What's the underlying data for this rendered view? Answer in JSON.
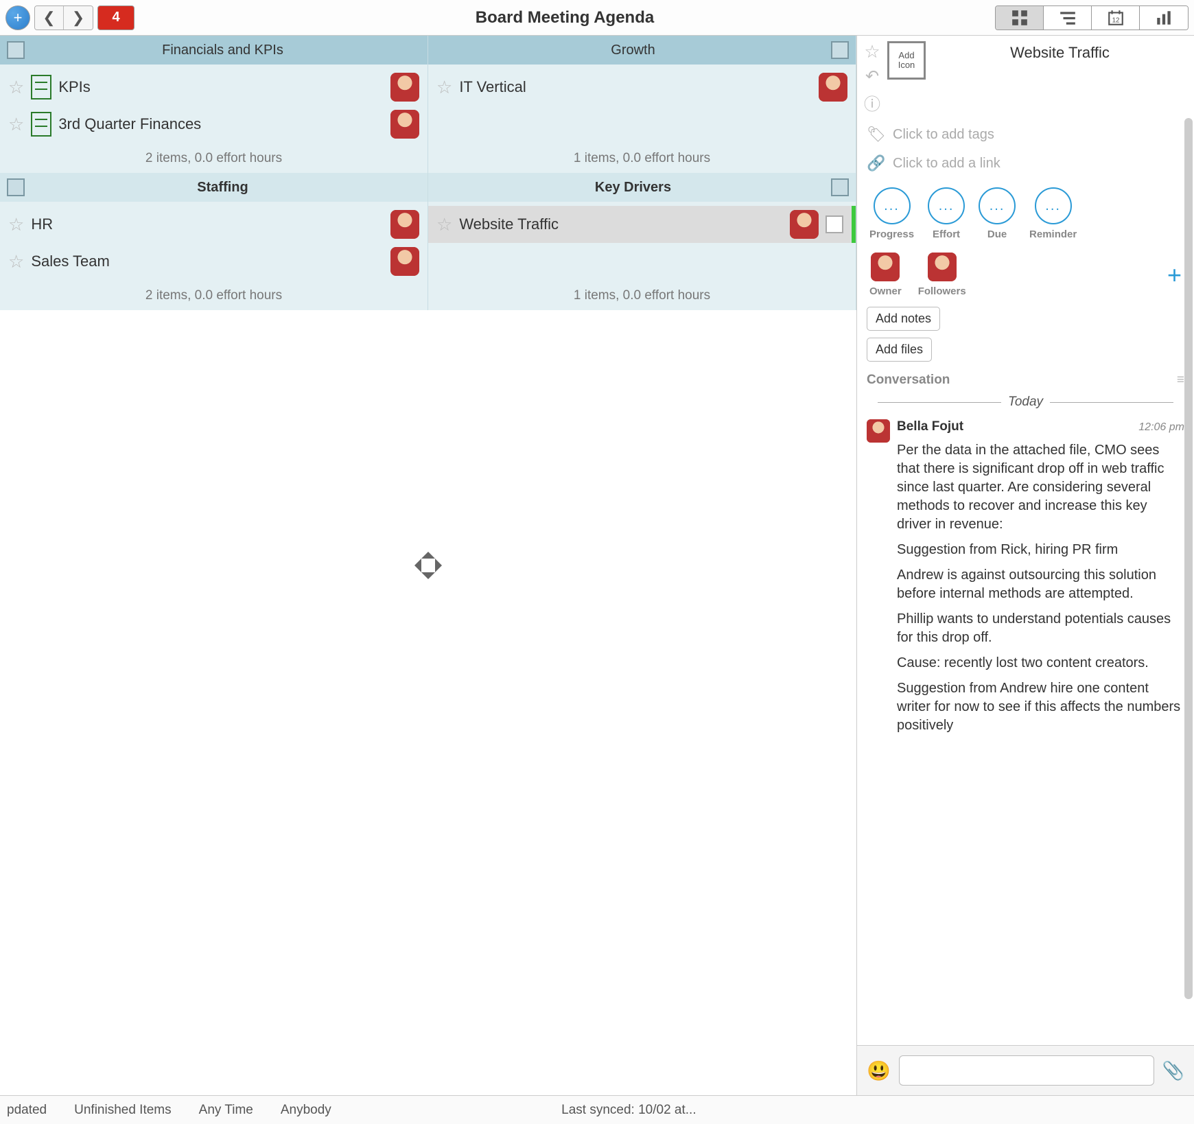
{
  "topbar": {
    "badge": "4",
    "title": "Board Meeting Agenda"
  },
  "quads": [
    {
      "title": "Financials and KPIs",
      "footer": "2 items, 0.0 effort hours",
      "cards": [
        {
          "title": "KPIs",
          "doc": true
        },
        {
          "title": "3rd Quarter Finances",
          "doc": true
        }
      ]
    },
    {
      "title": "Growth",
      "footer": "1 items, 0.0 effort hours",
      "cards": [
        {
          "title": "IT Vertical"
        }
      ]
    },
    {
      "title": "Staffing",
      "footer": "2 items, 0.0 effort hours",
      "cards": [
        {
          "title": "HR"
        },
        {
          "title": "Sales Team"
        }
      ]
    },
    {
      "title": "Key Drivers",
      "footer": "1 items, 0.0 effort hours",
      "cards": [
        {
          "title": "Website Traffic",
          "selected": true,
          "checkbox": true
        }
      ]
    }
  ],
  "bottombar": {
    "a": "pdated",
    "b": "Unfinished Items",
    "c": "Any Time",
    "d": "Anybody",
    "sync": "Last synced: 10/02 at..."
  },
  "side": {
    "title": "Website Traffic",
    "addicon": "Add Icon",
    "tags_placeholder": "Click to add tags",
    "link_placeholder": "Click to add a link",
    "props": {
      "progress": "Progress",
      "effort": "Effort",
      "due": "Due",
      "reminder": "Reminder",
      "dots": "..."
    },
    "people": {
      "owner": "Owner",
      "followers": "Followers"
    },
    "add_notes": "Add notes",
    "add_files": "Add files",
    "conversation": "Conversation",
    "today": "Today",
    "msg": {
      "name": "Bella Fojut",
      "time": "12:06 pm",
      "p1": "Per the data in the attached file, CMO sees that there is significant drop off in web traffic since last quarter. Are considering several methods to recover and increase this key driver in revenue:",
      "p2": "Suggestion from Rick, hiring PR firm",
      "p3": "Andrew is against outsourcing this solution before internal methods are attempted.",
      "p4": "Phillip wants to understand potentials causes for this drop off.",
      "p5": "Cause: recently lost two content creators.",
      "p6": "Suggestion from Andrew hire one content writer for now to see if this affects the numbers positively"
    }
  }
}
